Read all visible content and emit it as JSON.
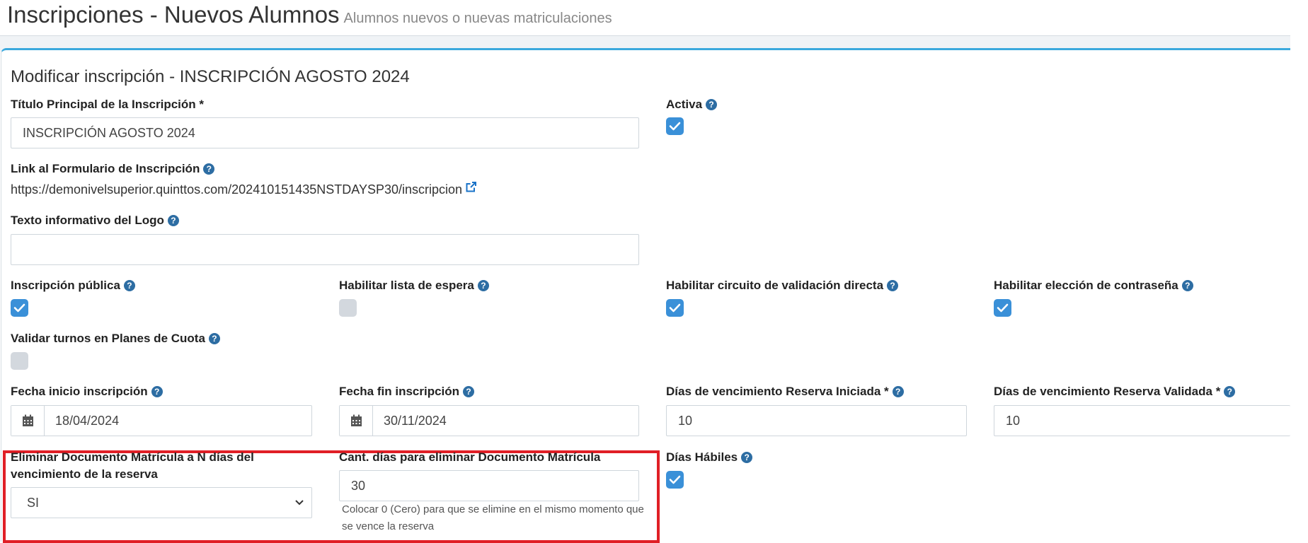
{
  "page": {
    "title": "Inscripciones - Nuevos Alumnos",
    "subtitle": "Alumnos nuevos o nuevas matriculaciones"
  },
  "form": {
    "title": "Modificar inscripción - INSCRIPCIÓN AGOSTO 2024",
    "titulo_label": "Título Principal de la Inscripción *",
    "titulo_value": "INSCRIPCIÓN AGOSTO  2024",
    "activa_label": "Activa",
    "activa_checked": true,
    "link_label": "Link al Formulario de Inscripción",
    "link_url": "https://demonivelsuperior.quinttos.com/202410151435NSTDAYSP30/inscripcion",
    "logo_text_label": "Texto informativo del Logo",
    "logo_text_value": "",
    "publica_label": "Inscripción pública",
    "publica_checked": true,
    "lista_espera_label": "Habilitar lista de espera",
    "lista_espera_checked": false,
    "validacion_directa_label": "Habilitar circuito de validación directa",
    "validacion_directa_checked": true,
    "eleccion_contrasena_label": "Habilitar elección de contraseña",
    "eleccion_contrasena_checked": true,
    "validar_turnos_label": "Validar turnos en Planes de Cuota",
    "validar_turnos_checked": false,
    "fecha_inicio_label": "Fecha inicio inscripción",
    "fecha_inicio_value": "18/04/2024",
    "fecha_fin_label": "Fecha fin inscripción",
    "fecha_fin_value": "30/11/2024",
    "dias_iniciada_label": "Días de vencimiento Reserva Iniciada *",
    "dias_iniciada_value": "10",
    "dias_validada_label": "Días de vencimiento Reserva Validada *",
    "dias_validada_value": "10",
    "eliminar_doc_label": "Eliminar Documento Matrícula a N días del vencimiento de la reserva",
    "eliminar_doc_value": "SI",
    "cant_dias_label": "Cant. días para eliminar Documento Matrícula",
    "cant_dias_value": "30",
    "cant_dias_help": "Colocar 0 (Cero) para que se elimine en el mismo momento que se vence la reserva",
    "dias_habiles_label": "Días Hábiles",
    "dias_habiles_checked": true
  },
  "icons": {
    "help": "question-circle-icon",
    "external_link": "external-link-icon",
    "calendar": "calendar-icon",
    "check": "check-icon",
    "chevron": "chevron-down-icon"
  },
  "colors": {
    "accent": "#3ba9dd",
    "checkbox_on": "#3a90d8",
    "checkbox_off": "#d3d8de",
    "help_icon": "#2d6da3",
    "highlight": "#e01f26",
    "link_icon": "#1a73c8"
  }
}
